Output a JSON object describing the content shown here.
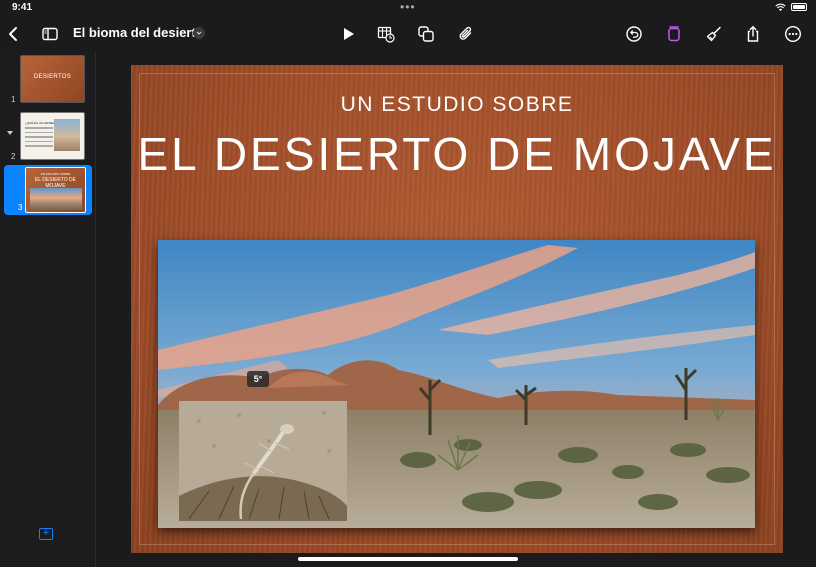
{
  "status_bar": {
    "time": "9:41",
    "dots": "•••"
  },
  "toolbar": {
    "document_title": "El bioma del desierto",
    "icons": [
      "back-icon",
      "sidebar-toggle-icon",
      "title-chevron-icon",
      "play-icon",
      "table-chart-insert-icon",
      "shapes-icon",
      "attachment-icon",
      "undo-icon",
      "format-icon",
      "paintbrush-icon",
      "share-icon",
      "more-icon"
    ],
    "accent_color": "#bf5af2"
  },
  "navigator": {
    "slides": [
      {
        "number": "1",
        "thumb_title": "DESIERTOS"
      },
      {
        "number": "2",
        "thumb_title": "¿QUÉ ES UN DESIERTO?"
      },
      {
        "number": "3",
        "thumb_subtitle": "UN ESTUDIO SOBRE",
        "thumb_title": "EL DESIERTO DE MOJAVE",
        "selected": true
      }
    ],
    "add_label": "+"
  },
  "slide": {
    "subtitle": "UN ESTUDIO SOBRE",
    "title": "EL DESIERTO DE MOJAVE",
    "rotation_badge": "5°",
    "background_color": "#a24f2a"
  }
}
